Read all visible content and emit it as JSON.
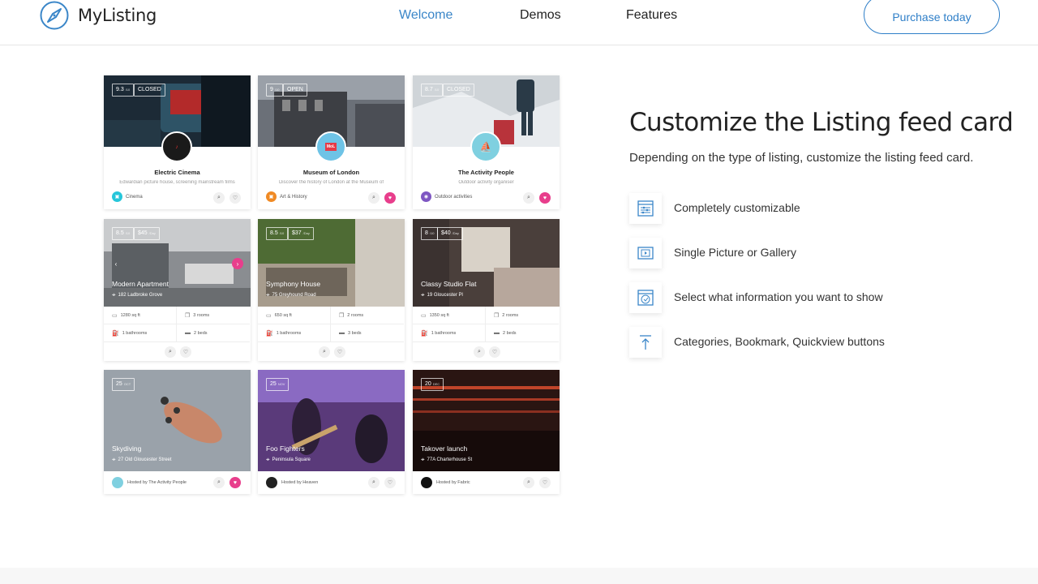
{
  "header": {
    "logo_text": "MyListing",
    "nav": [
      "Welcome",
      "Demos",
      "Features"
    ],
    "purchase_label": "Purchase today"
  },
  "colors": {
    "accent": "#3a86c8",
    "favorite": "#e83e8c"
  },
  "cards_row1": [
    {
      "rating": "9.3",
      "rating_unit": "/10",
      "status": "CLOSED",
      "title": "Electric Cinema",
      "description": "Edwardian picture house, screening mainstream films",
      "category": "Cinema",
      "favorited": false
    },
    {
      "rating": "9",
      "rating_unit": "/10",
      "status": "OPEN",
      "title": "Museum of London",
      "description": "Discover the history of London at the Museum of",
      "category": "Art & History",
      "favorited": true
    },
    {
      "rating": "8.7",
      "rating_unit": "/10",
      "status": "CLOSED",
      "title": "The Activity People",
      "description": "Outdoor activity organiser",
      "category": "Outdoor activities",
      "favorited": true
    }
  ],
  "cards_row2": [
    {
      "rating": "8.5",
      "rating_unit": "/10",
      "price": "$45",
      "price_unit": "/Day",
      "title": "Modern Apartment",
      "address": "182 Ladbroke Grove",
      "area": "1280 sq ft",
      "rooms": "3 rooms",
      "bathrooms": "1 bathrooms",
      "beds": "2 beds"
    },
    {
      "rating": "8.5",
      "rating_unit": "/10",
      "price": "$37",
      "price_unit": "/Day",
      "title": "Symphony House",
      "address": "75 Greyhound Road",
      "area": "650 sq ft",
      "rooms": "2 rooms",
      "bathrooms": "1 bathrooms",
      "beds": "3 beds"
    },
    {
      "rating": "8",
      "rating_unit": "/10",
      "price": "$40",
      "price_unit": "/Day",
      "title": "Classy Studio Flat",
      "address": "19 Gloucester Pl",
      "area": "1350 sq ft",
      "rooms": "2 rooms",
      "bathrooms": "1 bathrooms",
      "beds": "2 beds"
    }
  ],
  "cards_row3": [
    {
      "day": "25",
      "month": "OCT",
      "title": "Skydiving",
      "address": "27 Old Gloucester Street",
      "host": "Hosted by The Activity People",
      "favorited": true
    },
    {
      "day": "25",
      "month": "NOV",
      "title": "Foo Fighters",
      "address": "Peninsula Square",
      "host": "Hosted by Heaven",
      "favorited": false
    },
    {
      "day": "20",
      "month": "DEC",
      "title": "Takover launch",
      "address": "77A Charterhouse St",
      "host": "Hosted by Fabric",
      "favorited": false
    }
  ],
  "section": {
    "title": "Customize the Listing feed card",
    "subtitle": "Depending on the type of listing, customize the listing feed card."
  },
  "features": [
    {
      "icon": "sliders-icon",
      "label": "Completely customizable"
    },
    {
      "icon": "gallery-icon",
      "label": "Single Picture or Gallery"
    },
    {
      "icon": "info-select-icon",
      "label": "Select what information you want to show"
    },
    {
      "icon": "upload-arrow-icon",
      "label": "Categories, Bookmark, Quickview buttons"
    }
  ]
}
